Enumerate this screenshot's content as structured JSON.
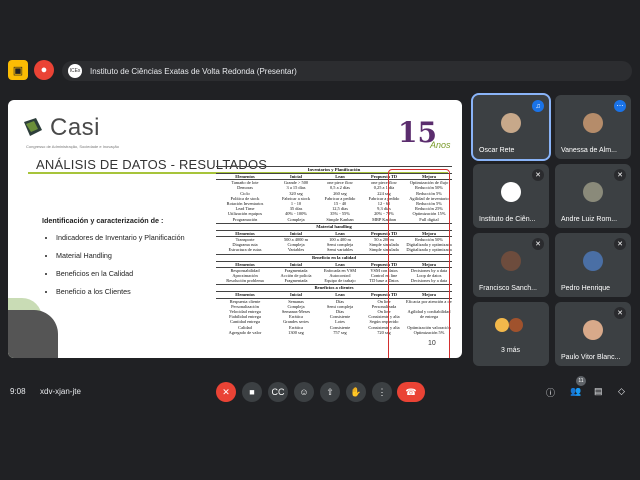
{
  "meeting": {
    "presenter_title": "Instituto de Ciências Exatas de Volta Redonda (Presentar)",
    "time": "9:08",
    "code": "xdv-xjan-jte",
    "participant_count": "11"
  },
  "slide": {
    "logo_text": "Casi",
    "logo_sub": "Congresso de Administração, Sociedade e Inovação",
    "badge_num": "15",
    "badge_text": "Anos",
    "title": "ANÁLISIS DE DATOS - RESULTADOS",
    "left_heading": "Identificación y caracterización de :",
    "bullets": [
      "Indicadores de Inventario y Planificación",
      "Material Handling",
      "Beneficios en la Calidad",
      "Beneficio a los Clientes"
    ],
    "page_num": "10",
    "sections": [
      {
        "title": "Inventarios y Planificación",
        "header": [
          "Elementos",
          "Inicial",
          "Lean",
          "Propuesta TD",
          "Mejora"
        ],
        "rows": [
          [
            "Tamaño de lote",
            "Grande > 500",
            "one piece flow",
            "one piece flow",
            "Optimización de flujo"
          ],
          [
            "Demoras",
            "3 a 15 días",
            "0,5 a 2 días",
            "0,25 a 1 día",
            "Reducción 50%"
          ],
          [
            "Ciclo",
            "320 seg",
            "260 seg",
            "224 seg",
            "Reducción 5%"
          ],
          [
            "Política de stock",
            "Fabricar a stock",
            "Fabricar a pedido",
            "Fabricar a pedido",
            "Agilidad de inventario"
          ],
          [
            "Rotación Inventarios",
            "1 - 10",
            "15 - 40",
            "12 - 65",
            "Reducción 5%"
          ],
          [
            "Lead Time",
            "35 días",
            "12,5 días",
            "9,3 días",
            "Reducción 25%"
          ],
          [
            "Utilización equipos",
            "40% - 100%",
            "35% - 55%",
            "20% - 78%",
            "Optimización 15%"
          ],
          [
            "Programación",
            "Compleja",
            "Simple Kanban",
            "MRP Kanban",
            "Full digital"
          ]
        ]
      },
      {
        "title": "Material handling",
        "header": [
          "Elementos",
          "Inicial",
          "Lean",
          "Propuesta TD",
          "Mejora"
        ],
        "rows": [
          [
            "Transporte",
            "500 a 4000 m",
            "100 a 400 m",
            "50 a 200 m",
            "Reducción 50%"
          ],
          [
            "Diagrama ruta",
            "Compleja",
            "Semi compleja",
            "Simple simulada",
            "Digitalizada y optimizada"
          ],
          [
            "Estructura de rutas",
            "Variables",
            "Semi variables",
            "Simple simulada",
            "Digitalizada y optimizada"
          ]
        ]
      },
      {
        "title": "Beneficio en la calidad",
        "header": [
          "Elementos",
          "Inicial",
          "Lean",
          "Propuesta TD",
          "Mejora"
        ],
        "rows": [
          [
            "Responsabilidad",
            "Fragmentada",
            "Enfocada en VSM",
            "VSM con datos",
            "Decisiones by a data"
          ],
          [
            "Aproximación",
            "Acción de policía",
            "Autocontrol",
            "Control en line",
            "Loop de datos"
          ],
          [
            "Resolución problema",
            "Fragmentada",
            "Equipo de trabajo",
            "TD base a Datos",
            "Decisiones by a data"
          ]
        ]
      },
      {
        "title": "Beneficios a clientes",
        "header": [
          "Elementos",
          "Inicial",
          "Lean",
          "Propuesta TD",
          "Mejora"
        ],
        "rows": [
          [
            "Respuesta cliente",
            "Semanas",
            "Días",
            "On line",
            "Eficacia por atención a demanda"
          ],
          [
            "Personalización",
            "Compleja",
            "Semi compleja",
            "Personalizada",
            ""
          ],
          [
            "Velocidad entrega",
            "Semanas-Meses",
            "Días",
            "On line",
            "Agilidad y confiabilidad"
          ],
          [
            "Fiabilidad entrega",
            "Errática",
            "Consistente",
            "Consistente y alta",
            "de entrega"
          ],
          [
            "Cantidad entrega",
            "Grandes series",
            "Lotes",
            "Según requerido",
            ""
          ],
          [
            "Calidad",
            "Errática",
            "Consistente",
            "Consistente y alta",
            "Optimización valoración"
          ],
          [
            "Agregado de valor",
            "1300 seg",
            "757 seg",
            "720 seg",
            "Optimización 5%"
          ]
        ]
      }
    ]
  },
  "participants": [
    {
      "name": "Oscar Rete",
      "muted": false
    },
    {
      "name": "Vanessa de Alm...",
      "muted": false
    },
    {
      "name": "Instituto de Ciên...",
      "muted": true
    },
    {
      "name": "Andre Luiz Rom...",
      "muted": true
    },
    {
      "name": "Francisco Sanch...",
      "muted": true
    },
    {
      "name": "Pedro Henrique",
      "muted": true
    },
    {
      "name": "3 más",
      "muted": false
    },
    {
      "name": "Paulo Vitor Blanc...",
      "muted": true
    }
  ],
  "icons": {
    "mic_off": "mic-off-icon",
    "camera": "camera-icon",
    "captions": "captions-icon",
    "emoji": "emoji-icon",
    "present": "present-icon",
    "hand": "hand-icon",
    "more": "more-icon",
    "end": "end-call-icon",
    "info": "info-icon",
    "people": "people-icon",
    "chat": "chat-icon",
    "activities": "activities-icon"
  },
  "colors": {
    "accent": "#8ab4f8",
    "danger": "#ea4335",
    "slide_rule": "#a7c43a",
    "box": "#d32f2f"
  }
}
